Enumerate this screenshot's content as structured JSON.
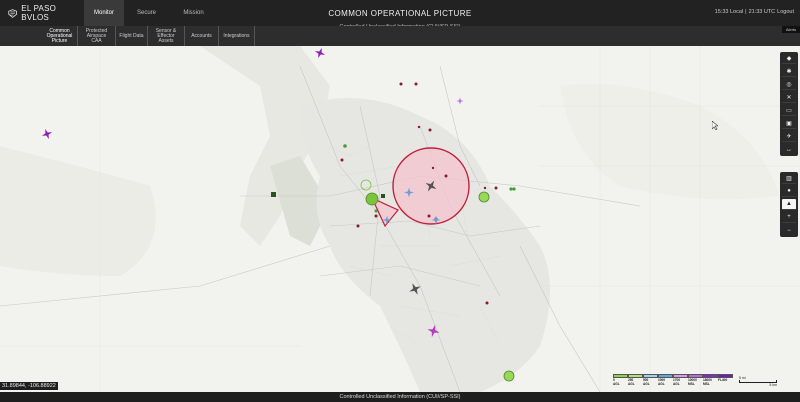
{
  "app": {
    "brand": "EL PASO BVLOS"
  },
  "header": {
    "title": "COMMON OPERATIONAL PICTURE",
    "classification": "Controlled Unclassified Information (CUI//SP-SSI)",
    "local_time": "15:33 Local",
    "separator": "|",
    "utc_time": "21:33 UTC",
    "logout": "Logout"
  },
  "tabs": [
    {
      "label": "Monitor"
    },
    {
      "label": "Secure"
    },
    {
      "label": "Mission"
    }
  ],
  "subnav": [
    {
      "line1": "Common",
      "line2": "Operational",
      "line3": "Picture"
    },
    {
      "line1": "Protected",
      "line2": "Airspace",
      "line3": "CAA"
    },
    {
      "line1": "Flight Data",
      "line2": "",
      "line3": ""
    },
    {
      "line1": "Sensor &",
      "line2": "Effector",
      "line3": "Assets"
    },
    {
      "line1": "Accounts",
      "line2": "",
      "line3": ""
    },
    {
      "line1": "Integrations",
      "line2": "",
      "line3": ""
    }
  ],
  "alerts_chip": "Alerts",
  "map": {
    "coordinates": "31.89844, -106.88922",
    "controls_top": [
      {
        "icon": "layers-icon",
        "glyph": "◆"
      },
      {
        "icon": "gear-icon",
        "glyph": "✱"
      },
      {
        "icon": "target-icon",
        "glyph": "◎"
      },
      {
        "icon": "tools-icon",
        "glyph": "✕"
      },
      {
        "icon": "ruler-icon",
        "glyph": "▭"
      },
      {
        "icon": "camera-icon",
        "glyph": "▣"
      },
      {
        "icon": "airplane-icon",
        "glyph": "✈"
      },
      {
        "icon": "distance-icon",
        "glyph": "↔"
      }
    ],
    "controls_bottom": [
      {
        "icon": "map-icon",
        "glyph": "▥"
      },
      {
        "icon": "pin-icon",
        "glyph": "●"
      },
      {
        "icon": "marker-icon",
        "glyph": "▲"
      },
      {
        "icon": "zoom-in-icon",
        "glyph": "+"
      },
      {
        "icon": "zoom-out-icon",
        "glyph": "−"
      }
    ],
    "legend": {
      "bands": [
        {
          "color": "#8fd14f",
          "top": "0",
          "bottom": "AGL"
        },
        {
          "color": "#b4e07a",
          "top": "250",
          "bottom": "AGL"
        },
        {
          "color": "#9bd3f0",
          "top": "500",
          "bottom": "AGL"
        },
        {
          "color": "#5fa8e0",
          "top": "1000",
          "bottom": "AGL"
        },
        {
          "color": "#d79be8",
          "top": "1700",
          "bottom": "AGL"
        },
        {
          "color": "#b869e0",
          "top": "10000",
          "bottom": "MSL"
        },
        {
          "color": "#7a2fc7",
          "top": "18000",
          "bottom": "MSL"
        },
        {
          "color": "#6a1fb4",
          "top": "FL400",
          "bottom": ""
        }
      ],
      "scale_top": "5 mi",
      "scale_bottom": "5 km"
    }
  },
  "colors": {
    "zone_fill": "#f5c2cd",
    "zone_stroke": "#c0203a",
    "purple": "#8a1fb8",
    "magenta": "#b23fbf",
    "blue": "#6f9ed6",
    "grey_ac": "#555555",
    "green": "#7cc43c"
  },
  "footer": {
    "text": "Controlled Unclassified Information (CUI//SP-SSI)"
  }
}
